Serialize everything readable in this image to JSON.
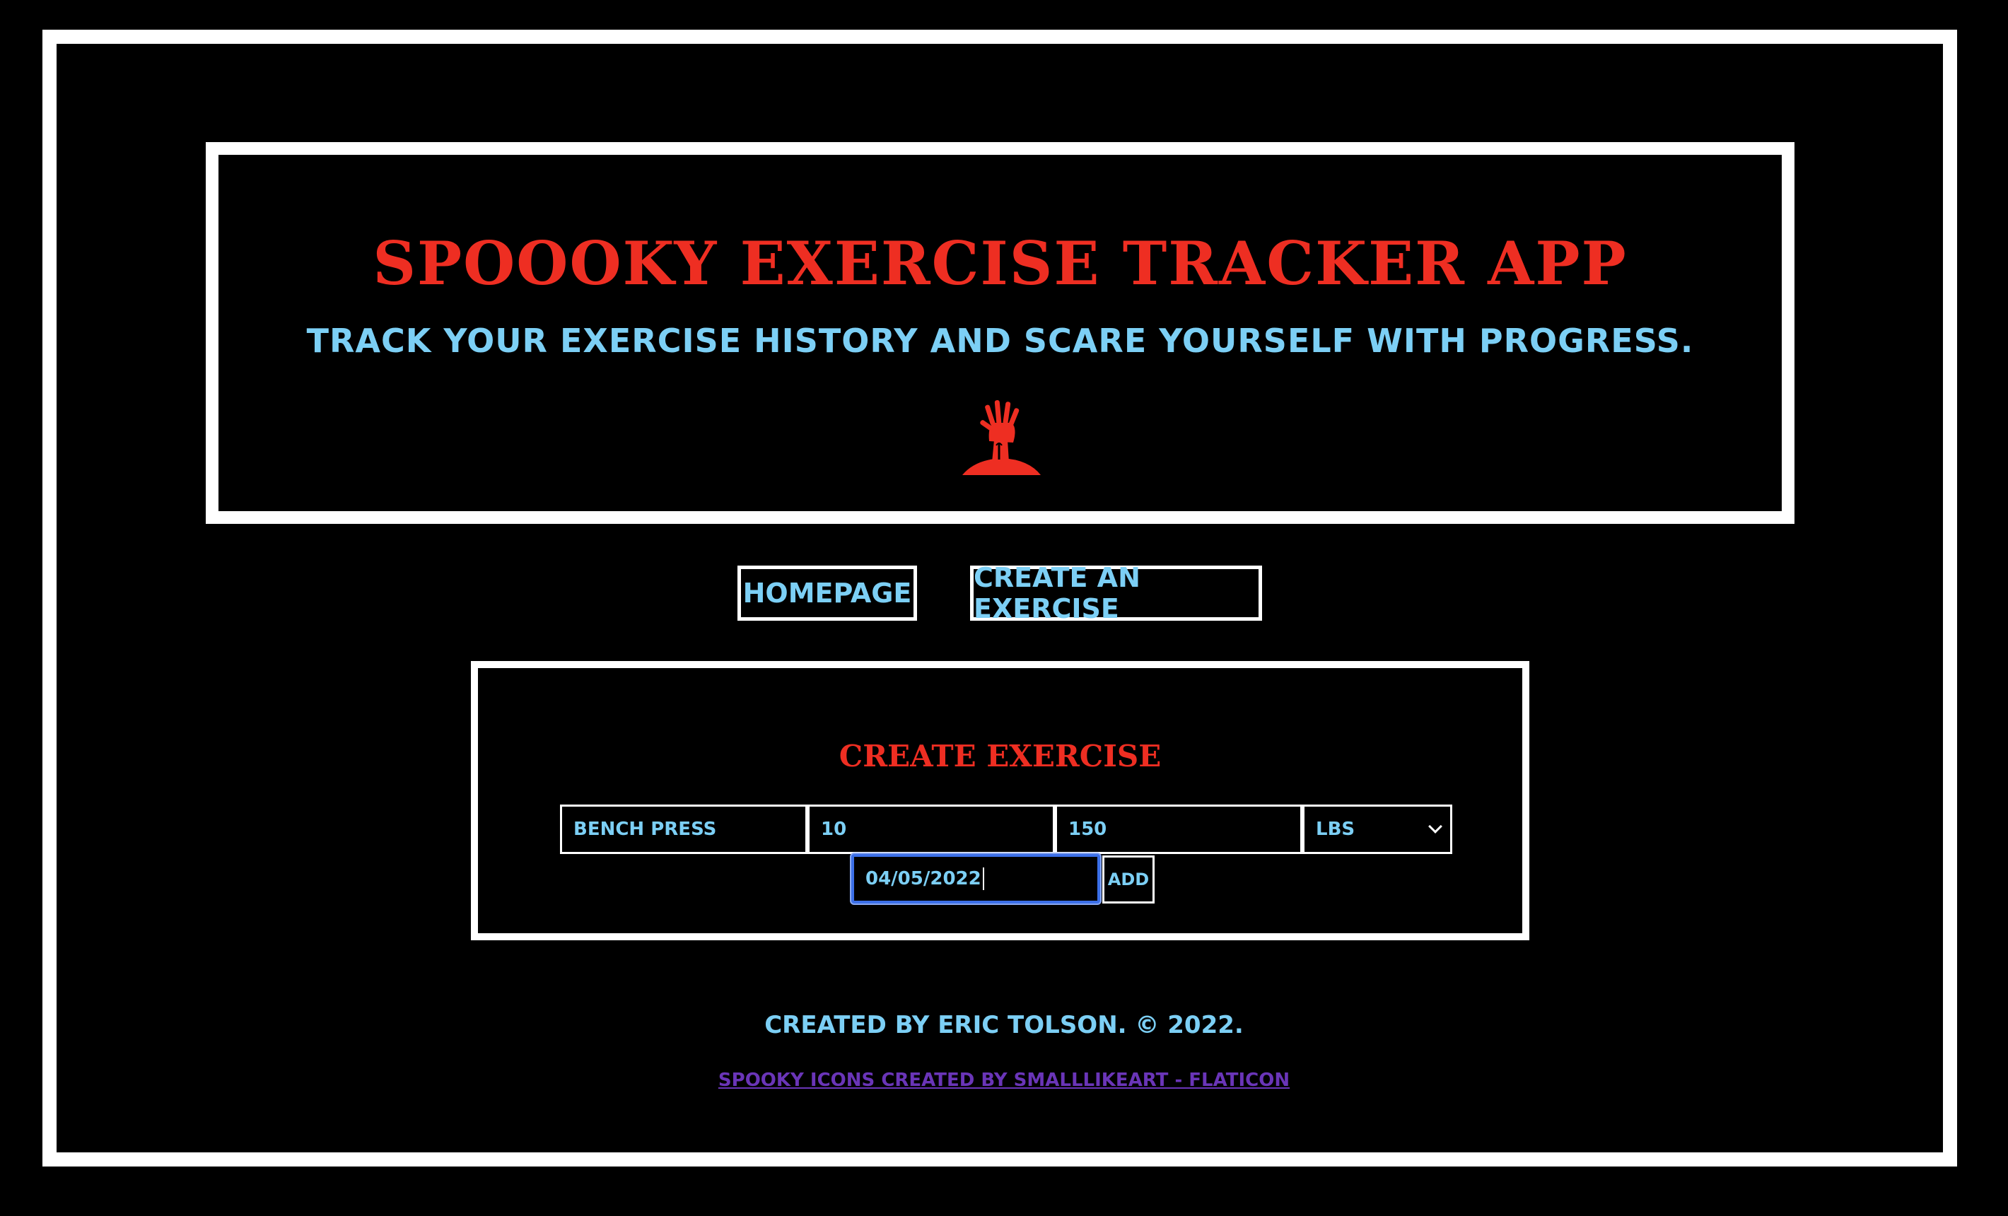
{
  "header": {
    "title": "Spoooky Exercise Tracker App",
    "subtitle": "Track your exercise history and scare yourself with progress.",
    "logo_icon": "zombie-hand-icon"
  },
  "nav": {
    "homepage_label": "Homepage",
    "create_label": "Create an Exercise"
  },
  "form": {
    "title": "Create Exercise",
    "name_value": "Bench Press",
    "reps_value": "10",
    "weight_value": "150",
    "unit_selected": "lbs",
    "date_value": "04/05/2022",
    "add_label": "Add"
  },
  "footer": {
    "credit": "Created by Eric Tolson. © 2022.",
    "icons_link": "Spooky icons created by Smalllikeart - Flaticon"
  },
  "colors": {
    "background": "#000000",
    "title_red": "#ee2e22",
    "accent_blue": "#7ccff5",
    "link_purple": "#6a35b8",
    "focus_blue": "#3b6fe8"
  }
}
